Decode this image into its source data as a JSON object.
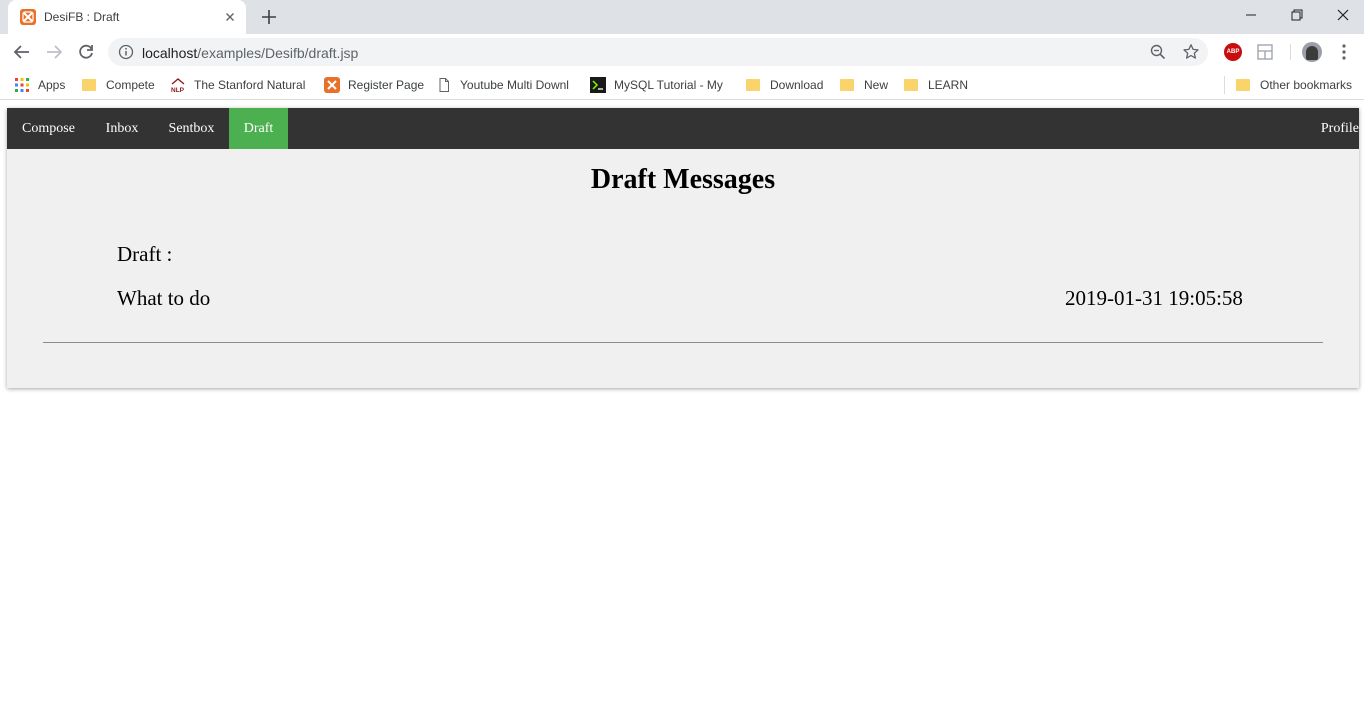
{
  "browser": {
    "tab_title": "DesiFB : Draft",
    "url_host": "localhost",
    "url_path": "/examples/Desifb/draft.jsp",
    "bookmarks": [
      {
        "label": "Apps",
        "icon": "apps-grid-icon"
      },
      {
        "label": "Compete",
        "icon": "folder-icon"
      },
      {
        "label": "The Stanford Natural",
        "icon": "nlp-icon"
      },
      {
        "label": "Register Page",
        "icon": "xampp-icon"
      },
      {
        "label": "Youtube Multi Downl",
        "icon": "page-icon"
      },
      {
        "label": "MySQL Tutorial - My",
        "icon": "terminal-icon"
      },
      {
        "label": "Download",
        "icon": "folder-icon"
      },
      {
        "label": "New",
        "icon": "folder-icon"
      },
      {
        "label": "LEARN",
        "icon": "folder-icon"
      }
    ],
    "other_bookmarks": "Other bookmarks",
    "extension_abp_label": "ABP"
  },
  "nav": {
    "items": [
      {
        "label": "Compose"
      },
      {
        "label": "Inbox"
      },
      {
        "label": "Sentbox"
      },
      {
        "label": "Draft",
        "active": true
      }
    ],
    "profile": "Profile",
    "active_color": "#4caf50",
    "bar_color": "#333333"
  },
  "page": {
    "heading": "Draft Messages",
    "draft_label": "Draft :",
    "message": {
      "text": "What to do",
      "timestamp": "2019-01-31 19:05:58"
    }
  }
}
